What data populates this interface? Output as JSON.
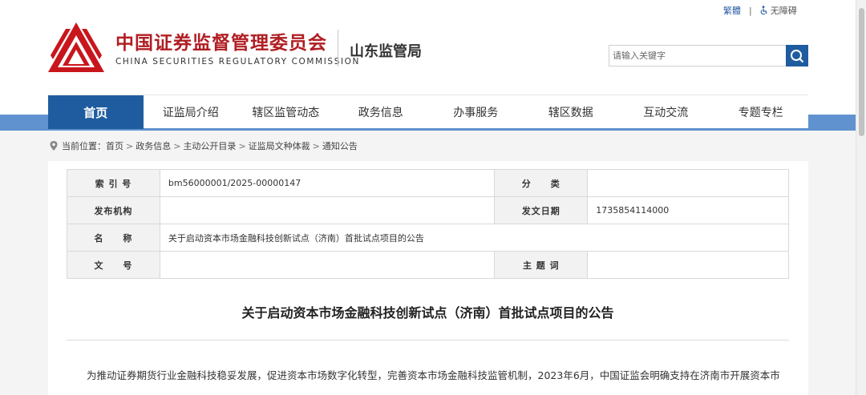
{
  "header": {
    "org_name_cn": "中国证券监督管理委员会",
    "org_name_en": "CHINA SECURITIES REGULATORY COMMISSION",
    "bureau": "山东监管局",
    "top_links": {
      "traditional": "繁體",
      "separator": "|",
      "accessibility": "无障碍"
    },
    "search": {
      "placeholder": "请输入关键字"
    },
    "colors": {
      "brand_red": "#b01e23",
      "nav_blue": "#1f5c9f"
    }
  },
  "nav": {
    "items": [
      {
        "label": "首页",
        "active": true
      },
      {
        "label": "证监局介绍"
      },
      {
        "label": "辖区监管动态"
      },
      {
        "label": "政务信息"
      },
      {
        "label": "办事服务"
      },
      {
        "label": "辖区数据"
      },
      {
        "label": "互动交流"
      },
      {
        "label": "专题专栏"
      }
    ]
  },
  "breadcrumb": {
    "prefix": "当前位置：",
    "items": [
      "首页",
      "政务信息",
      "主动公开目录",
      "证监局文种体裁",
      "通知公告"
    ],
    "separator": ">"
  },
  "meta": {
    "index_label": "索 引 号",
    "index_value": "bm56000001/2025-00000147",
    "category_label": "分　　类",
    "category_value": "",
    "publisher_label": "发布机构",
    "publisher_value": "",
    "date_label": "发文日期",
    "date_value": "1735854114000",
    "name_label": "名　　称",
    "name_value": "关于启动资本市场金融科技创新试点（济南）首批试点项目的公告",
    "docno_label": "文　　号",
    "docno_value": "",
    "subject_label": "主 题 词",
    "subject_value": ""
  },
  "article": {
    "title": "关于启动资本市场金融科技创新试点（济南）首批试点项目的公告",
    "paragraph_1": "为推动证券期货行业金融科技稳妥发展，促进资本市场数字化转型，完善资本市场金融科技监管机制，2023年6月，中国证监会明确支持在济南市开展资本市"
  }
}
